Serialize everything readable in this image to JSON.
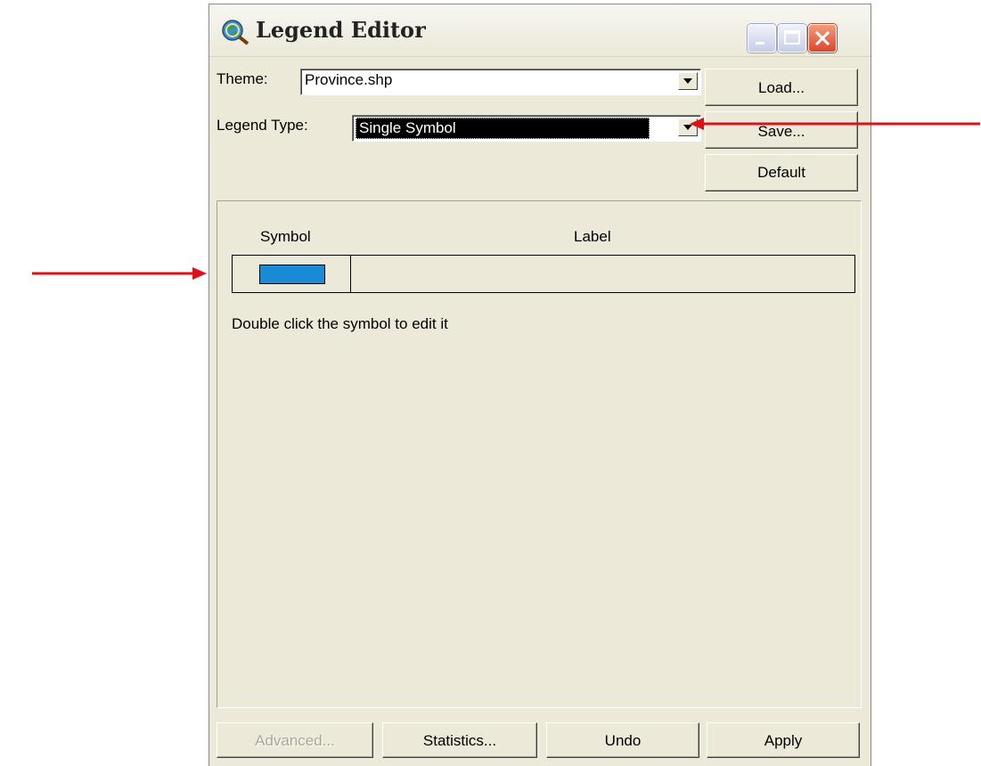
{
  "window": {
    "title": "Legend Editor"
  },
  "theme": {
    "label": "Theme:",
    "value": "Province.shp"
  },
  "legend_type": {
    "label": "Legend Type:",
    "value": "Single Symbol"
  },
  "side_buttons": {
    "load": "Load...",
    "save": "Save...",
    "default": "Default"
  },
  "legend": {
    "symbol_header": "Symbol",
    "label_header": "Label",
    "rows": [
      {
        "symbol_color": "#1a8ad4",
        "label": ""
      }
    ],
    "hint": "Double click the symbol to edit it"
  },
  "bottom_buttons": {
    "advanced": "Advanced...",
    "statistics": "Statistics...",
    "undo": "Undo",
    "apply": "Apply"
  },
  "colors": {
    "annotation_arrow": "#e0101a",
    "selection": "#000000"
  }
}
